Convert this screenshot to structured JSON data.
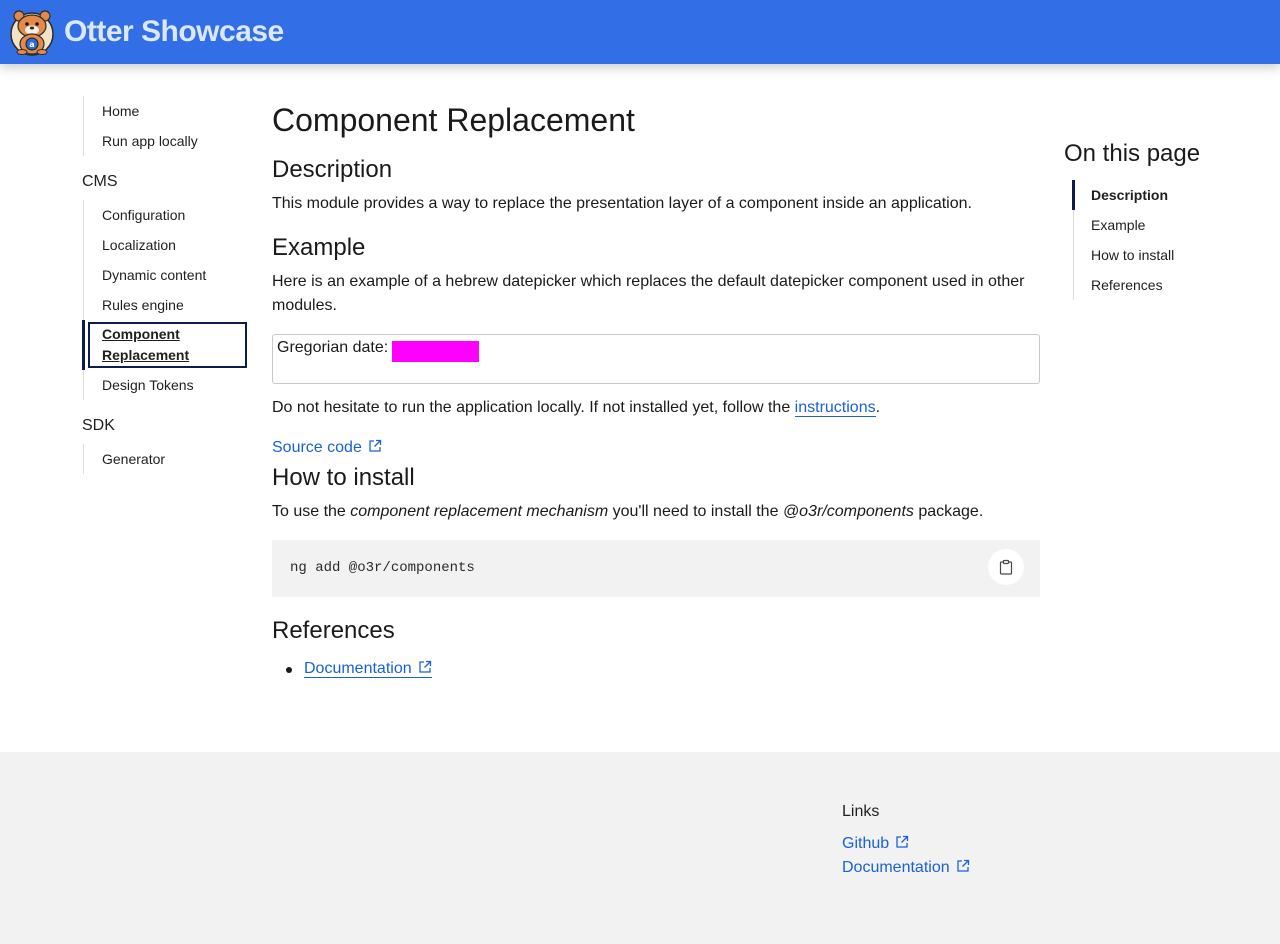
{
  "header": {
    "brand": "Otter Showcase",
    "logo_icon": "otter-logo-icon",
    "bg_color": "#326fe6"
  },
  "sidebar": {
    "top_items": [
      "Home",
      "Run app locally"
    ],
    "sections": [
      {
        "title": "CMS",
        "items": [
          "Configuration",
          "Localization",
          "Dynamic content",
          "Rules engine",
          "Component Replacement",
          "Design Tokens"
        ],
        "active": "Component Replacement"
      },
      {
        "title": "SDK",
        "items": [
          "Generator"
        ]
      }
    ]
  },
  "main": {
    "title": "Component Replacement",
    "description": {
      "heading": "Description",
      "text": "This module provides a way to replace the presentation layer of a component inside an application."
    },
    "example": {
      "heading": "Example",
      "text": "Here is an example of a hebrew datepicker which replaces the default datepicker component used in other modules.",
      "demo_label": "Gregorian date:",
      "demo_input_color": "#ff00ff",
      "hint_prefix": "Do not hesitate to run the application locally. If not installed yet, follow the ",
      "hint_link": "instructions",
      "hint_suffix": ".",
      "source_link": "Source code"
    },
    "install": {
      "heading": "How to install",
      "text_1": "To use the ",
      "text_em1": "component replacement mechanism",
      "text_2": " you'll need to install the ",
      "text_em2": "@o3r/components",
      "text_3": " package.",
      "code": "ng add @o3r/components",
      "copy_icon": "clipboard-icon"
    },
    "references": {
      "heading": "References",
      "items": [
        "Documentation"
      ]
    }
  },
  "toc": {
    "title": "On this page",
    "items": [
      "Description",
      "Example",
      "How to install",
      "References"
    ],
    "active": "Description"
  },
  "footer": {
    "title": "Links",
    "links": [
      "Github",
      "Documentation"
    ]
  },
  "colors": {
    "accent": "#326fe6",
    "link": "#1a61d6",
    "active_marker": "#0e1b4d"
  }
}
